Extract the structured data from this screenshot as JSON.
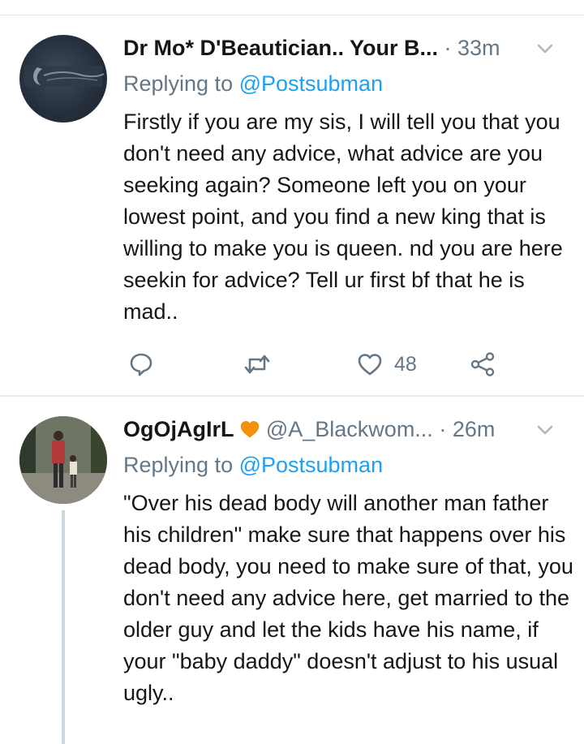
{
  "tweets": [
    {
      "display_name": "Dr Mo* D'Beautician.. Your B...",
      "handle": "",
      "time": "· 33m",
      "replying_prefix": "Replying to ",
      "replying_to": "@Postsubman",
      "text": "Firstly if you are my sis, I will tell you that you don't need any advice, what advice are you seeking again? Someone left you on your lowest point, and you find a new king that is willing to make you is queen. nd you are here seekin for advice? Tell ur first bf that he is mad..",
      "likes": "48",
      "icons": [
        "reply-icon",
        "retweet-icon",
        "heart-icon",
        "share-icon",
        "chevron-down-icon"
      ]
    },
    {
      "display_name": "OgOjAgIrL",
      "handle": "@A_Blackwom...",
      "time": "· 26m",
      "replying_prefix": "Replying to ",
      "replying_to": "@Postsubman",
      "text": "\"Over his dead body will another man father his children\" make sure that happens over his dead body, you need to make sure of that, you don't need any advice here, get married to the older guy and let the kids have his name, if your \"baby daddy\" doesn't adjust to his usual ugly..",
      "icons": [
        "orange-heart-icon",
        "chevron-down-icon"
      ]
    }
  ],
  "colors": {
    "link": "#1da1f2",
    "secondary_text": "#657786",
    "heart_badge": "#e0245e",
    "thread_line": "#ccd6dd"
  }
}
